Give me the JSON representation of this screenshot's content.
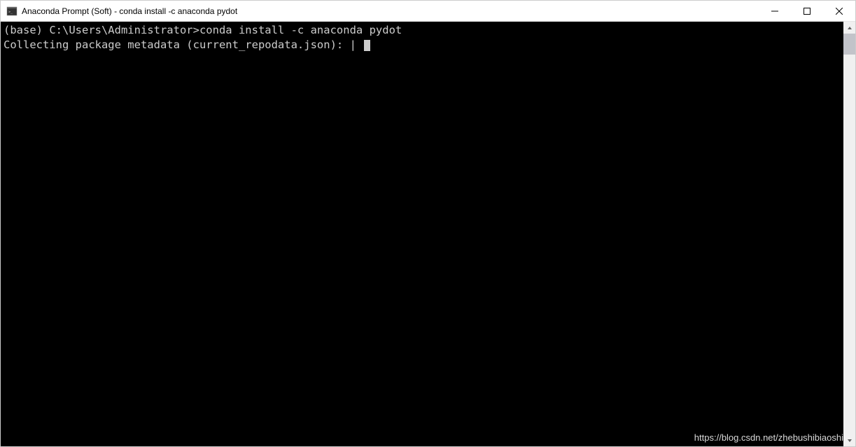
{
  "window": {
    "title": "Anaconda Prompt (Soft) - conda  install -c anaconda pydot"
  },
  "terminal": {
    "lines": [
      "(base) C:\\Users\\Administrator>conda install -c anaconda pydot",
      "Collecting package metadata (current_repodata.json): | "
    ]
  },
  "watermark": {
    "text": "https://blog.csdn.net/zhebushibiaoshi"
  }
}
